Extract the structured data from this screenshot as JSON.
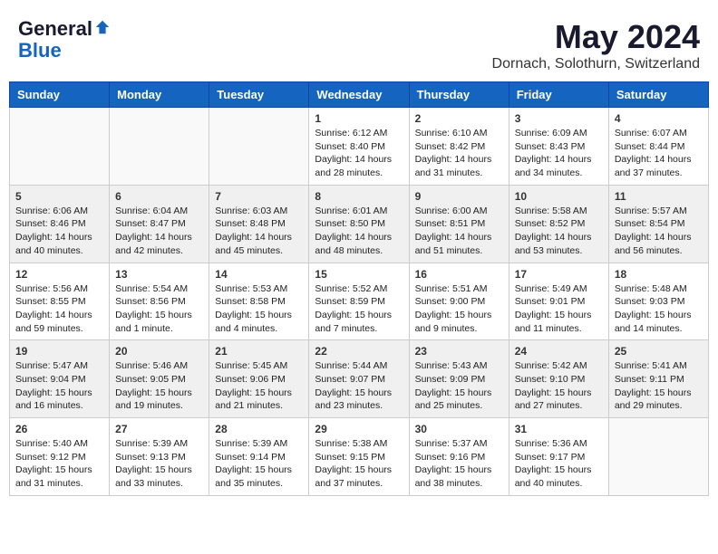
{
  "header": {
    "logo_line1": "General",
    "logo_line2": "Blue",
    "main_title": "May 2024",
    "subtitle": "Dornach, Solothurn, Switzerland"
  },
  "weekdays": [
    "Sunday",
    "Monday",
    "Tuesday",
    "Wednesday",
    "Thursday",
    "Friday",
    "Saturday"
  ],
  "weeks": [
    [
      {
        "day": "",
        "info": ""
      },
      {
        "day": "",
        "info": ""
      },
      {
        "day": "",
        "info": ""
      },
      {
        "day": "1",
        "info": "Sunrise: 6:12 AM\nSunset: 8:40 PM\nDaylight: 14 hours\nand 28 minutes."
      },
      {
        "day": "2",
        "info": "Sunrise: 6:10 AM\nSunset: 8:42 PM\nDaylight: 14 hours\nand 31 minutes."
      },
      {
        "day": "3",
        "info": "Sunrise: 6:09 AM\nSunset: 8:43 PM\nDaylight: 14 hours\nand 34 minutes."
      },
      {
        "day": "4",
        "info": "Sunrise: 6:07 AM\nSunset: 8:44 PM\nDaylight: 14 hours\nand 37 minutes."
      }
    ],
    [
      {
        "day": "5",
        "info": "Sunrise: 6:06 AM\nSunset: 8:46 PM\nDaylight: 14 hours\nand 40 minutes."
      },
      {
        "day": "6",
        "info": "Sunrise: 6:04 AM\nSunset: 8:47 PM\nDaylight: 14 hours\nand 42 minutes."
      },
      {
        "day": "7",
        "info": "Sunrise: 6:03 AM\nSunset: 8:48 PM\nDaylight: 14 hours\nand 45 minutes."
      },
      {
        "day": "8",
        "info": "Sunrise: 6:01 AM\nSunset: 8:50 PM\nDaylight: 14 hours\nand 48 minutes."
      },
      {
        "day": "9",
        "info": "Sunrise: 6:00 AM\nSunset: 8:51 PM\nDaylight: 14 hours\nand 51 minutes."
      },
      {
        "day": "10",
        "info": "Sunrise: 5:58 AM\nSunset: 8:52 PM\nDaylight: 14 hours\nand 53 minutes."
      },
      {
        "day": "11",
        "info": "Sunrise: 5:57 AM\nSunset: 8:54 PM\nDaylight: 14 hours\nand 56 minutes."
      }
    ],
    [
      {
        "day": "12",
        "info": "Sunrise: 5:56 AM\nSunset: 8:55 PM\nDaylight: 14 hours\nand 59 minutes."
      },
      {
        "day": "13",
        "info": "Sunrise: 5:54 AM\nSunset: 8:56 PM\nDaylight: 15 hours\nand 1 minute."
      },
      {
        "day": "14",
        "info": "Sunrise: 5:53 AM\nSunset: 8:58 PM\nDaylight: 15 hours\nand 4 minutes."
      },
      {
        "day": "15",
        "info": "Sunrise: 5:52 AM\nSunset: 8:59 PM\nDaylight: 15 hours\nand 7 minutes."
      },
      {
        "day": "16",
        "info": "Sunrise: 5:51 AM\nSunset: 9:00 PM\nDaylight: 15 hours\nand 9 minutes."
      },
      {
        "day": "17",
        "info": "Sunrise: 5:49 AM\nSunset: 9:01 PM\nDaylight: 15 hours\nand 11 minutes."
      },
      {
        "day": "18",
        "info": "Sunrise: 5:48 AM\nSunset: 9:03 PM\nDaylight: 15 hours\nand 14 minutes."
      }
    ],
    [
      {
        "day": "19",
        "info": "Sunrise: 5:47 AM\nSunset: 9:04 PM\nDaylight: 15 hours\nand 16 minutes."
      },
      {
        "day": "20",
        "info": "Sunrise: 5:46 AM\nSunset: 9:05 PM\nDaylight: 15 hours\nand 19 minutes."
      },
      {
        "day": "21",
        "info": "Sunrise: 5:45 AM\nSunset: 9:06 PM\nDaylight: 15 hours\nand 21 minutes."
      },
      {
        "day": "22",
        "info": "Sunrise: 5:44 AM\nSunset: 9:07 PM\nDaylight: 15 hours\nand 23 minutes."
      },
      {
        "day": "23",
        "info": "Sunrise: 5:43 AM\nSunset: 9:09 PM\nDaylight: 15 hours\nand 25 minutes."
      },
      {
        "day": "24",
        "info": "Sunrise: 5:42 AM\nSunset: 9:10 PM\nDaylight: 15 hours\nand 27 minutes."
      },
      {
        "day": "25",
        "info": "Sunrise: 5:41 AM\nSunset: 9:11 PM\nDaylight: 15 hours\nand 29 minutes."
      }
    ],
    [
      {
        "day": "26",
        "info": "Sunrise: 5:40 AM\nSunset: 9:12 PM\nDaylight: 15 hours\nand 31 minutes."
      },
      {
        "day": "27",
        "info": "Sunrise: 5:39 AM\nSunset: 9:13 PM\nDaylight: 15 hours\nand 33 minutes."
      },
      {
        "day": "28",
        "info": "Sunrise: 5:39 AM\nSunset: 9:14 PM\nDaylight: 15 hours\nand 35 minutes."
      },
      {
        "day": "29",
        "info": "Sunrise: 5:38 AM\nSunset: 9:15 PM\nDaylight: 15 hours\nand 37 minutes."
      },
      {
        "day": "30",
        "info": "Sunrise: 5:37 AM\nSunset: 9:16 PM\nDaylight: 15 hours\nand 38 minutes."
      },
      {
        "day": "31",
        "info": "Sunrise: 5:36 AM\nSunset: 9:17 PM\nDaylight: 15 hours\nand 40 minutes."
      },
      {
        "day": "",
        "info": ""
      }
    ]
  ]
}
